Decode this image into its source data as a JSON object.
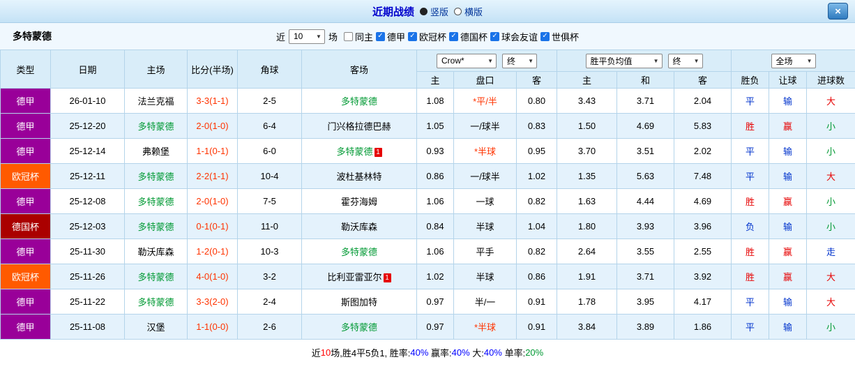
{
  "titlebar": {
    "title": "近期战绩",
    "close": "×",
    "layout_options": [
      {
        "label": "竖版",
        "selected": true
      },
      {
        "label": "横版",
        "selected": false
      }
    ]
  },
  "filterbar": {
    "team": "多特蒙德",
    "near_label": "近",
    "matches_select": "10",
    "matches_label": "场",
    "checkboxes": [
      {
        "label": "同主",
        "checked": false
      },
      {
        "label": "德甲",
        "checked": true
      },
      {
        "label": "欧冠杯",
        "checked": true
      },
      {
        "label": "德国杯",
        "checked": true
      },
      {
        "label": "球会友谊",
        "checked": true
      },
      {
        "label": "世俱杯",
        "checked": true
      }
    ]
  },
  "table": {
    "column_headers": [
      "类型",
      "日期",
      "主场",
      "比分(半场)",
      "角球",
      "客场"
    ],
    "selects": {
      "company": "Crow*",
      "company_state": "终",
      "europe": "胜平负均值",
      "europe_state": "终",
      "scope": "全场"
    },
    "subheaders": [
      "主",
      "盘口",
      "客",
      "主",
      "和",
      "客",
      "胜负",
      "让球",
      "进球数"
    ]
  },
  "colors": {
    "league": {
      "德甲": "#990099",
      "欧冠杯": "#ff5a00",
      "德国杯": "#aa0000"
    },
    "score": "#ff3300",
    "subject_team": "#009933",
    "win": "#e60000",
    "draw_loss": "#0033cc",
    "under": "#009933"
  },
  "rows": [
    {
      "league": "德甲",
      "date": "26-01-10",
      "home": "法兰克福",
      "home_subject": false,
      "score": "3-3(1-1)",
      "corner": "2-5",
      "away": "多特蒙德",
      "away_subject": true,
      "away_card": "",
      "ah_home": "1.08",
      "pankou": "*平/半",
      "pankou_red": true,
      "ah_away": "0.80",
      "eu_home": "3.43",
      "eu_draw": "3.71",
      "eu_away": "2.04",
      "result": "平",
      "handicap": "输",
      "goals": "大"
    },
    {
      "league": "德甲",
      "date": "25-12-20",
      "home": "多特蒙德",
      "home_subject": true,
      "score": "2-0(1-0)",
      "corner": "6-4",
      "away": "门兴格拉德巴赫",
      "away_subject": false,
      "away_card": "",
      "ah_home": "1.05",
      "pankou": "一/球半",
      "pankou_red": false,
      "ah_away": "0.83",
      "eu_home": "1.50",
      "eu_draw": "4.69",
      "eu_away": "5.83",
      "result": "胜",
      "handicap": "赢",
      "goals": "小"
    },
    {
      "league": "德甲",
      "date": "25-12-14",
      "home": "弗赖堡",
      "home_subject": false,
      "score": "1-1(0-1)",
      "corner": "6-0",
      "away": "多特蒙德",
      "away_subject": true,
      "away_card": "1",
      "ah_home": "0.93",
      "pankou": "*半球",
      "pankou_red": true,
      "ah_away": "0.95",
      "eu_home": "3.70",
      "eu_draw": "3.51",
      "eu_away": "2.02",
      "result": "平",
      "handicap": "输",
      "goals": "小"
    },
    {
      "league": "欧冠杯",
      "date": "25-12-11",
      "home": "多特蒙德",
      "home_subject": true,
      "score": "2-2(1-1)",
      "corner": "10-4",
      "away": "波杜基林特",
      "away_subject": false,
      "away_card": "",
      "ah_home": "0.86",
      "pankou": "一/球半",
      "pankou_red": false,
      "ah_away": "1.02",
      "eu_home": "1.35",
      "eu_draw": "5.63",
      "eu_away": "7.48",
      "result": "平",
      "handicap": "输",
      "goals": "大"
    },
    {
      "league": "德甲",
      "date": "25-12-08",
      "home": "多特蒙德",
      "home_subject": true,
      "score": "2-0(1-0)",
      "corner": "7-5",
      "away": "霍芬海姆",
      "away_subject": false,
      "away_card": "",
      "ah_home": "1.06",
      "pankou": "一球",
      "pankou_red": false,
      "ah_away": "0.82",
      "eu_home": "1.63",
      "eu_draw": "4.44",
      "eu_away": "4.69",
      "result": "胜",
      "handicap": "赢",
      "goals": "小"
    },
    {
      "league": "德国杯",
      "date": "25-12-03",
      "home": "多特蒙德",
      "home_subject": true,
      "score": "0-1(0-1)",
      "corner": "11-0",
      "away": "勒沃库森",
      "away_subject": false,
      "away_card": "",
      "ah_home": "0.84",
      "pankou": "半球",
      "pankou_red": false,
      "ah_away": "1.04",
      "eu_home": "1.80",
      "eu_draw": "3.93",
      "eu_away": "3.96",
      "result": "负",
      "handicap": "输",
      "goals": "小"
    },
    {
      "league": "德甲",
      "date": "25-11-30",
      "home": "勒沃库森",
      "home_subject": false,
      "score": "1-2(0-1)",
      "corner": "10-3",
      "away": "多特蒙德",
      "away_subject": true,
      "away_card": "",
      "ah_home": "1.06",
      "pankou": "平手",
      "pankou_red": false,
      "ah_away": "0.82",
      "eu_home": "2.64",
      "eu_draw": "3.55",
      "eu_away": "2.55",
      "result": "胜",
      "handicap": "赢",
      "goals": "走"
    },
    {
      "league": "欧冠杯",
      "date": "25-11-26",
      "home": "多特蒙德",
      "home_subject": true,
      "score": "4-0(1-0)",
      "corner": "3-2",
      "away": "比利亚雷亚尔",
      "away_subject": false,
      "away_card": "1",
      "ah_home": "1.02",
      "pankou": "半球",
      "pankou_red": false,
      "ah_away": "0.86",
      "eu_home": "1.91",
      "eu_draw": "3.71",
      "eu_away": "3.92",
      "result": "胜",
      "handicap": "赢",
      "goals": "大"
    },
    {
      "league": "德甲",
      "date": "25-11-22",
      "home": "多特蒙德",
      "home_subject": true,
      "score": "3-3(2-0)",
      "corner": "2-4",
      "away": "斯图加特",
      "away_subject": false,
      "away_card": "",
      "ah_home": "0.97",
      "pankou": "半/一",
      "pankou_red": false,
      "ah_away": "0.91",
      "eu_home": "1.78",
      "eu_draw": "3.95",
      "eu_away": "4.17",
      "result": "平",
      "handicap": "输",
      "goals": "大"
    },
    {
      "league": "德甲",
      "date": "25-11-08",
      "home": "汉堡",
      "home_subject": false,
      "score": "1-1(0-0)",
      "corner": "2-6",
      "away": "多特蒙德",
      "away_subject": true,
      "away_card": "",
      "ah_home": "0.97",
      "pankou": "*半球",
      "pankou_red": true,
      "ah_away": "0.91",
      "eu_home": "3.84",
      "eu_draw": "3.89",
      "eu_away": "1.86",
      "result": "平",
      "handicap": "输",
      "goals": "小"
    }
  ],
  "summary": {
    "segments": [
      {
        "text": "近",
        "color": "#000000"
      },
      {
        "text": "10",
        "color": "#ff0000"
      },
      {
        "text": "场,胜4平5负1, 胜率:",
        "color": "#000000"
      },
      {
        "text": "40%",
        "color": "#0000ff"
      },
      {
        "text": " 赢率:",
        "color": "#000000"
      },
      {
        "text": "40%",
        "color": "#0000ff"
      },
      {
        "text": " 大:",
        "color": "#000000"
      },
      {
        "text": "40%",
        "color": "#0000ff"
      },
      {
        "text": " 单率:",
        "color": "#000000"
      },
      {
        "text": "20%",
        "color": "#009933"
      }
    ]
  }
}
